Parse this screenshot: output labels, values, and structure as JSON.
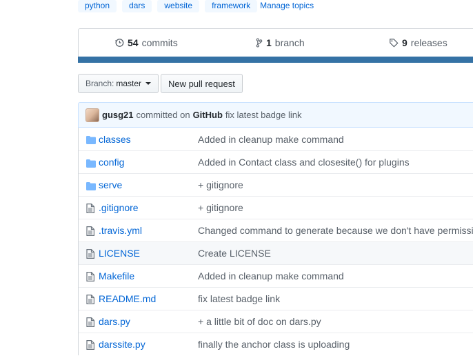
{
  "topics": {
    "tags": [
      "python",
      "dars",
      "website",
      "framework"
    ],
    "manage_label": "Manage topics"
  },
  "summary": {
    "commits_count": "54",
    "commits_label": "commits",
    "branch_count": "1",
    "branch_label": "branch",
    "releases_count": "9",
    "releases_label": "releases",
    "language_color": "#3572A5"
  },
  "toolbar": {
    "branch_prefix": "Branch:",
    "branch_name": "master",
    "new_pr_label": "New pull request"
  },
  "latest_commit": {
    "author": "gusg21",
    "mid_text": "committed on",
    "platform": "GitHub",
    "message": "fix latest badge link"
  },
  "files": [
    {
      "type": "dir",
      "icon": "folder-icon",
      "name": "classes",
      "message": "Added in cleanup make command"
    },
    {
      "type": "dir",
      "icon": "folder-icon",
      "name": "config",
      "message": "Added in Contact class and closesite() for plugins"
    },
    {
      "type": "dir",
      "icon": "folder-icon",
      "name": "serve",
      "message": "+ gitignore"
    },
    {
      "type": "file",
      "icon": "file-icon",
      "name": ".gitignore",
      "message": "+ gitignore"
    },
    {
      "type": "file",
      "icon": "file-icon",
      "name": ".travis.yml",
      "message": "Changed command to generate because we don't have permission"
    },
    {
      "type": "file",
      "icon": "file-icon",
      "name": "LICENSE",
      "message": "Create LICENSE"
    },
    {
      "type": "file",
      "icon": "file-icon",
      "name": "Makefile",
      "message": "Added in cleanup make command"
    },
    {
      "type": "file",
      "icon": "file-icon",
      "name": "README.md",
      "message": "fix latest badge link"
    },
    {
      "type": "file",
      "icon": "file-icon",
      "name": "dars.py",
      "message": "+ a little bit of doc on dars.py"
    },
    {
      "type": "file",
      "icon": "file-icon",
      "name": "darssite.py",
      "message": "finally the anchor class is uploading"
    }
  ]
}
